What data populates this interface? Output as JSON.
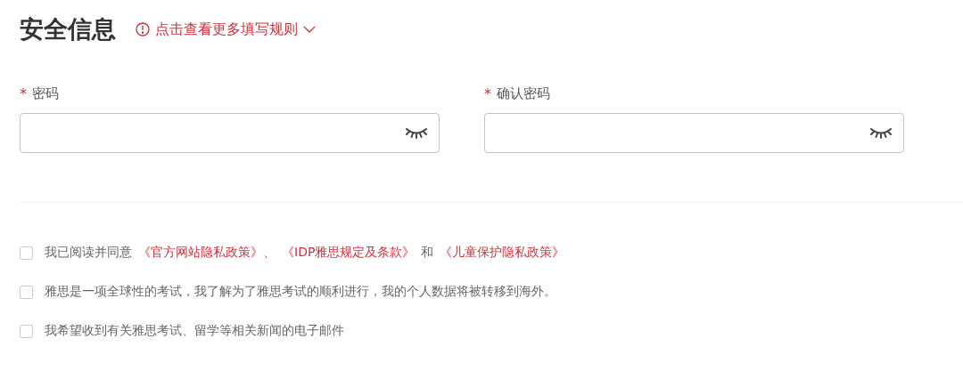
{
  "section": {
    "title": "安全信息",
    "rules_link": "点击查看更多填写规则",
    "rules_expanded": false
  },
  "fields": [
    {
      "label": "密码",
      "required": true,
      "required_mark": "*"
    },
    {
      "label": "确认密码",
      "required": true,
      "required_mark": "*"
    }
  ],
  "agreements": [
    {
      "checked": false,
      "parts": [
        {
          "kind": "text",
          "text": "我已阅读并同意"
        },
        {
          "kind": "link",
          "text": "《官方网站隐私政策》、"
        },
        {
          "kind": "link",
          "text": "《IDP雅思规定及条款》"
        },
        {
          "kind": "text",
          "text": "和"
        },
        {
          "kind": "link",
          "text": "《儿童保护隐私政策》"
        }
      ]
    },
    {
      "checked": false,
      "parts": [
        {
          "kind": "text",
          "text": "雅思是一项全球性的考试，我了解为了雅思考试的顺利进行，我的个人数据将被转移到海外。"
        }
      ]
    },
    {
      "checked": false,
      "parts": [
        {
          "kind": "text",
          "text": "我希望收到有关雅思考试、留学等相关新闻的电子邮件"
        }
      ]
    }
  ]
}
